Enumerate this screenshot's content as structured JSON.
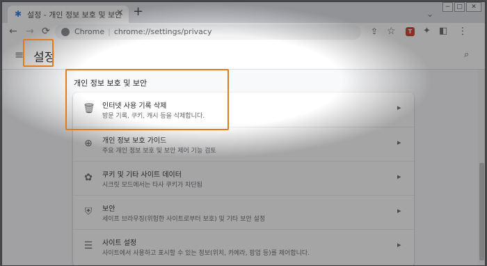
{
  "tab": {
    "title": "설정 - 개인 정보 보호 및 보안",
    "close": "×",
    "favicon": "settings-gear-icon"
  },
  "new_tab": "+",
  "window_controls": {
    "minimize": "−",
    "maximize": "□",
    "close": "✕"
  },
  "toolbar": {
    "back": "←",
    "forward": "→",
    "reload": "⟳",
    "omnibox_site": "Chrome",
    "omnibox_sep": "|",
    "omnibox_url": "chrome://settings/privacy",
    "share": "⇪",
    "bookmark": "☆",
    "extension_badge": "T",
    "extensions": "✦",
    "sidepanel": "◧",
    "menu": "⋮"
  },
  "header": {
    "menu": "≡",
    "title": "설정",
    "search": "⌕"
  },
  "section_title": "개인 정보 보호 및 보안",
  "rows": [
    {
      "icon": "trash-icon",
      "glyph": "🗑",
      "title": "인터넷 사용 기록 삭제",
      "subtitle": "방문 기록, 쿠키, 캐시 등을 삭제합니다.",
      "arrow": "▸"
    },
    {
      "icon": "compass-icon",
      "glyph": "⊕",
      "title": "개인 정보 보호 가이드",
      "subtitle": "주요 개인 정보 보호 및 보안 제어 기능 검토",
      "arrow": "▸"
    },
    {
      "icon": "cookie-icon",
      "glyph": "✿",
      "title": "쿠키 및 기타 사이트 데이터",
      "subtitle": "시크릿 모드에서는 타사 쿠키가 차단됨",
      "arrow": "▸"
    },
    {
      "icon": "shield-icon",
      "glyph": "⛨",
      "title": "보안",
      "subtitle": "세이프 브라우징(위험한 사이트로부터 보호) 및 기타 보안 설정",
      "arrow": "▸"
    },
    {
      "icon": "tune-icon",
      "glyph": "☰",
      "title": "사이트 설정",
      "subtitle": "사이트에서 사용하고 표시할 수 있는 정보(위치, 카메라, 팝업 등)를 제어합니다.",
      "arrow": "▸"
    }
  ],
  "colors": {
    "highlight": "#e07b1c",
    "accent": "#1a73e8"
  }
}
